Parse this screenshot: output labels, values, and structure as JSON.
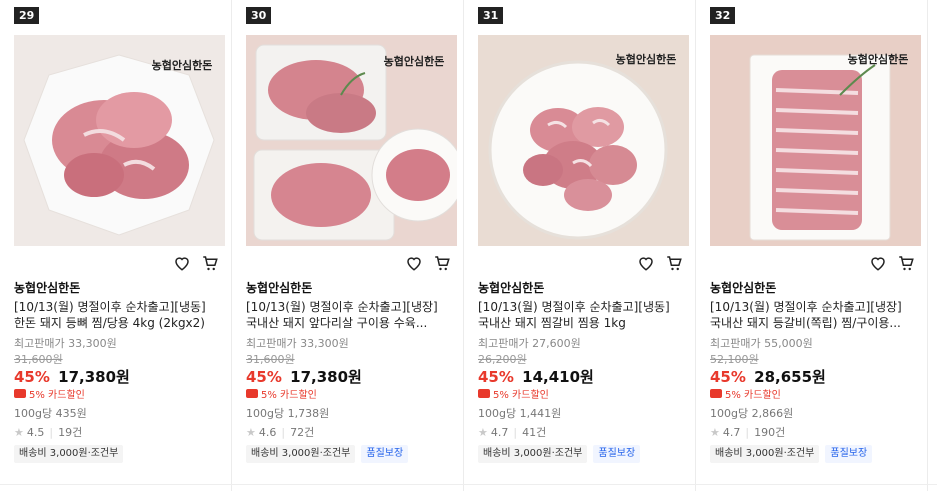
{
  "products": [
    {
      "rank": "29",
      "brand": "농협안심한돈",
      "title_line1": "[10/13(월) 명절이후 순차출고][냉동]",
      "title_line2": "한돈 돼지 등뼈 찜/당용 4kg (2kgx2)",
      "ref_price": "최고판매가 33,300원",
      "original_price": "31,600원",
      "discount": "45%",
      "price": "17,380원",
      "card_discount": "5% 카드할인",
      "unit_price": "100g당 435원",
      "rating": "4.5",
      "reviews": "19건",
      "shipping": "배송비 3,000원·조건부",
      "quality_tag": "",
      "logo": "농협안심한돈",
      "image_tone": "#efe9e6"
    },
    {
      "rank": "30",
      "brand": "농협안심한돈",
      "title_line1": "[10/13(월) 명절이후 순차출고][냉장]",
      "title_line2": "국내산 돼지 앞다리살 구이용 수육...",
      "ref_price": "최고판매가 33,300원",
      "original_price": "31,600원",
      "discount": "45%",
      "price": "17,380원",
      "card_discount": "5% 카드할인",
      "unit_price": "100g당 1,738원",
      "rating": "4.6",
      "reviews": "72건",
      "shipping": "배송비 3,000원·조건부",
      "quality_tag": "품질보장",
      "logo": "농협안심한돈",
      "image_tone": "#ead6d0"
    },
    {
      "rank": "31",
      "brand": "농협안심한돈",
      "title_line1": "[10/13(월) 명절이후 순차출고][냉동]",
      "title_line2": "국내산 돼지 찜갈비 찜용 1kg",
      "ref_price": "최고판매가 27,600원",
      "original_price": "26,200원",
      "discount": "45%",
      "price": "14,410원",
      "card_discount": "5% 카드할인",
      "unit_price": "100g당 1,441원",
      "rating": "4.7",
      "reviews": "41건",
      "shipping": "배송비 3,000원·조건부",
      "quality_tag": "품질보장",
      "logo": "농협안심한돈",
      "image_tone": "#e9dcd3"
    },
    {
      "rank": "32",
      "brand": "농협안심한돈",
      "title_line1": "[10/13(월) 명절이후 순차출고][냉장]",
      "title_line2": "국내산 돼지 등갈비(쪽립) 찜/구이용...",
      "ref_price": "최고판매가 55,000원",
      "original_price": "52,100원",
      "discount": "45%",
      "price": "28,655원",
      "card_discount": "5% 카드할인",
      "unit_price": "100g당 2,866원",
      "rating": "4.7",
      "reviews": "190건",
      "shipping": "배송비 3,000원·조건부",
      "quality_tag": "품질보장",
      "logo": "농협안심한돈",
      "image_tone": "#e8cfc6"
    }
  ],
  "colors": {
    "discount": "#e8392c",
    "tag_blue": "#2563eb"
  },
  "icons": {
    "wishlist": "heart-icon",
    "cart": "cart-icon",
    "star": "star-icon",
    "card": "card-icon"
  }
}
